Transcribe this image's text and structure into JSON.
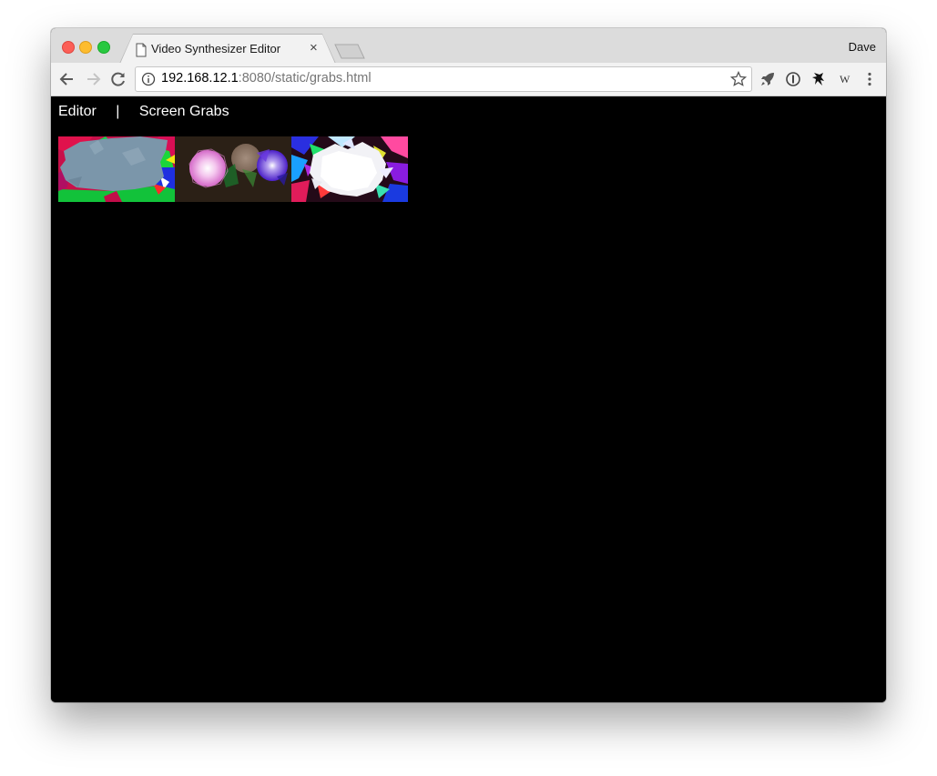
{
  "browser": {
    "tab_title": "Video Synthesizer Editor",
    "tab_close": "×",
    "profile_name": "Dave",
    "url_host": "192.168.12.1",
    "url_rest": ":8080/static/grabs.html"
  },
  "page": {
    "nav": {
      "editor_label": "Editor",
      "separator": "|",
      "screen_grabs_label": "Screen Grabs"
    },
    "grabs": [
      {
        "name": "screen-grab-1"
      },
      {
        "name": "screen-grab-2"
      },
      {
        "name": "screen-grab-3"
      }
    ]
  },
  "colors": {
    "page_background": "#000000",
    "nav_text": "#ffffff",
    "titlebar": "#dcdcdc",
    "toolbar": "#f2f2f2"
  }
}
